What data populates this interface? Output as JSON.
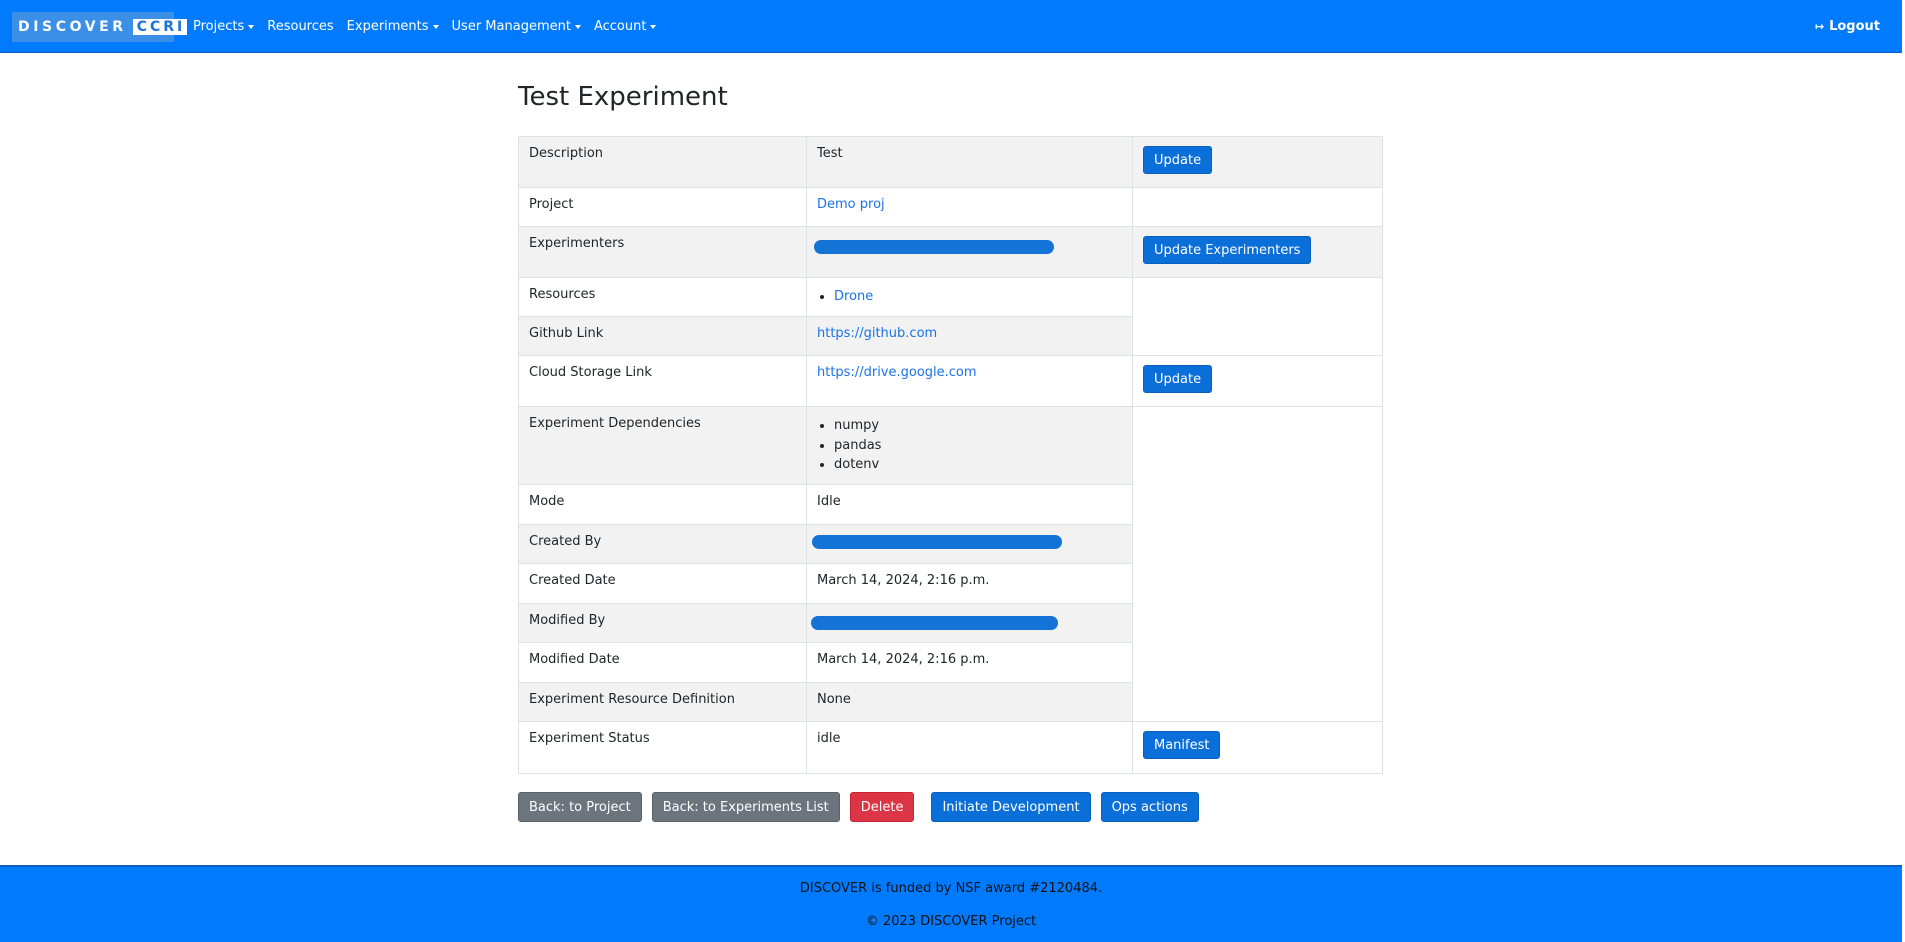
{
  "brand": {
    "word1": "DISCOVER",
    "word2": "CCRI"
  },
  "nav": {
    "items": [
      {
        "label": "Projects",
        "dropdown": true
      },
      {
        "label": "Resources",
        "dropdown": false
      },
      {
        "label": "Experiments",
        "dropdown": true
      },
      {
        "label": "User Management",
        "dropdown": true
      },
      {
        "label": "Account",
        "dropdown": true
      }
    ],
    "logout": "Logout"
  },
  "page": {
    "title": "Test Experiment"
  },
  "details": {
    "description": {
      "label": "Description",
      "value": "Test",
      "action": "Update"
    },
    "project": {
      "label": "Project",
      "value": "Demo proj"
    },
    "experimenters": {
      "label": "Experimenters",
      "action": "Update Experimenters"
    },
    "resources": {
      "label": "Resources",
      "items": [
        "Drone"
      ]
    },
    "github": {
      "label": "Github Link",
      "value": "https://github.com"
    },
    "cloud": {
      "label": "Cloud Storage Link",
      "value": "https://drive.google.com",
      "action": "Update"
    },
    "dependencies": {
      "label": "Experiment Dependencies",
      "items": [
        "numpy",
        "pandas",
        "dotenv"
      ]
    },
    "mode": {
      "label": "Mode",
      "value": "Idle"
    },
    "created_by": {
      "label": "Created By"
    },
    "created_date": {
      "label": "Created Date",
      "value": "March 14, 2024, 2:16 p.m."
    },
    "modified_by": {
      "label": "Modified By"
    },
    "modified_date": {
      "label": "Modified Date",
      "value": "March 14, 2024, 2:16 p.m."
    },
    "resource_def": {
      "label": "Experiment Resource Definition",
      "value": "None"
    },
    "status": {
      "label": "Experiment Status",
      "value": "idle",
      "action": "Manifest"
    }
  },
  "actions": {
    "back_project": "Back: to Project",
    "back_list": "Back: to Experiments List",
    "delete": "Delete",
    "initiate": "Initiate Development",
    "ops": "Ops actions"
  },
  "footer": {
    "funding": "DISCOVER is funded by NSF award #2120484.",
    "copyright": "© 2023 DISCOVER Project"
  },
  "colors": {
    "primary": "#007bff",
    "button_blue": "#0b6fd9",
    "button_gray": "#6c757d",
    "button_red": "#dc3545",
    "link": "#1a73e8",
    "redaction": "#1473d6"
  }
}
